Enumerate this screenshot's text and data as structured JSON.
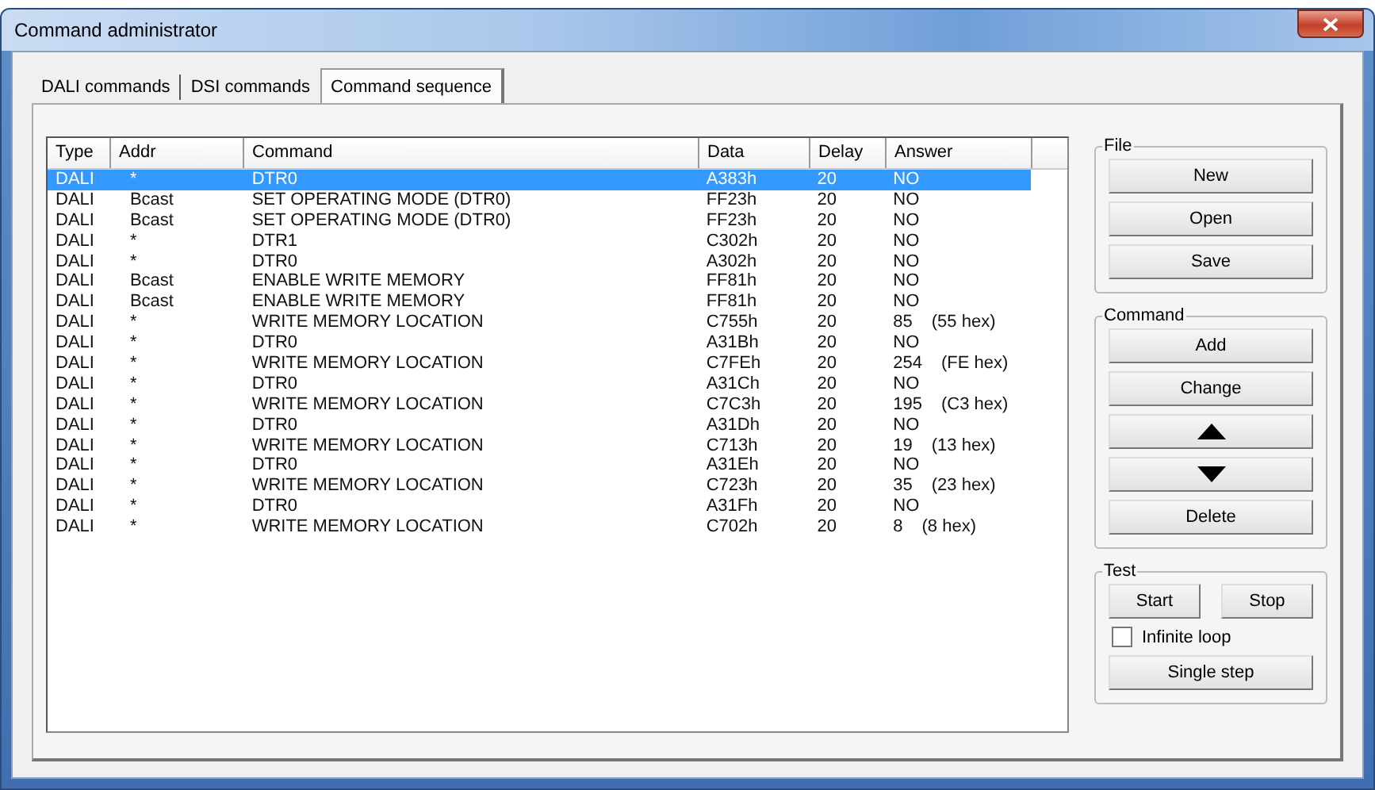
{
  "window": {
    "title": "Command administrator"
  },
  "tabs": [
    {
      "label": "DALI commands",
      "selected": false
    },
    {
      "label": "DSI commands",
      "selected": false
    },
    {
      "label": "Command sequence",
      "selected": true
    }
  ],
  "table": {
    "columns": [
      "Type",
      "Addr",
      "Command",
      "Data",
      "Delay",
      "Answer"
    ],
    "rows": [
      {
        "type": "DALI",
        "addr": "*",
        "command": "DTR0",
        "data": "A383h",
        "delay": "20",
        "answer": "NO",
        "selected": true
      },
      {
        "type": "DALI",
        "addr": "Bcast",
        "command": "SET OPERATING MODE (DTR0)",
        "data": "FF23h",
        "delay": "20",
        "answer": "NO",
        "selected": false
      },
      {
        "type": "DALI",
        "addr": "Bcast",
        "command": "SET OPERATING MODE (DTR0)",
        "data": "FF23h",
        "delay": "20",
        "answer": "NO",
        "selected": false
      },
      {
        "type": "DALI",
        "addr": "*",
        "command": "DTR1",
        "data": "C302h",
        "delay": "20",
        "answer": "NO",
        "selected": false
      },
      {
        "type": "DALI",
        "addr": "*",
        "command": "DTR0",
        "data": "A302h",
        "delay": "20",
        "answer": "NO",
        "selected": false
      },
      {
        "type": "DALI",
        "addr": "Bcast",
        "command": "ENABLE WRITE MEMORY",
        "data": "FF81h",
        "delay": "20",
        "answer": "NO",
        "selected": false
      },
      {
        "type": "DALI",
        "addr": "Bcast",
        "command": "ENABLE WRITE MEMORY",
        "data": "FF81h",
        "delay": "20",
        "answer": "NO",
        "selected": false
      },
      {
        "type": "DALI",
        "addr": "*",
        "command": "WRITE MEMORY LOCATION",
        "data": "C755h",
        "delay": "20",
        "answer": "85",
        "answer_hex": "(55 hex)",
        "selected": false
      },
      {
        "type": "DALI",
        "addr": "*",
        "command": "DTR0",
        "data": "A31Bh",
        "delay": "20",
        "answer": "NO",
        "selected": false
      },
      {
        "type": "DALI",
        "addr": "*",
        "command": "WRITE MEMORY LOCATION",
        "data": "C7FEh",
        "delay": "20",
        "answer": "254",
        "answer_hex": "(FE hex)",
        "selected": false
      },
      {
        "type": "DALI",
        "addr": "*",
        "command": "DTR0",
        "data": "A31Ch",
        "delay": "20",
        "answer": "NO",
        "selected": false
      },
      {
        "type": "DALI",
        "addr": "*",
        "command": "WRITE MEMORY LOCATION",
        "data": "C7C3h",
        "delay": "20",
        "answer": "195",
        "answer_hex": "(C3 hex)",
        "selected": false
      },
      {
        "type": "DALI",
        "addr": "*",
        "command": "DTR0",
        "data": "A31Dh",
        "delay": "20",
        "answer": "NO",
        "selected": false
      },
      {
        "type": "DALI",
        "addr": "*",
        "command": "WRITE MEMORY LOCATION",
        "data": "C713h",
        "delay": "20",
        "answer": "19",
        "answer_hex": "(13 hex)",
        "selected": false
      },
      {
        "type": "DALI",
        "addr": "*",
        "command": "DTR0",
        "data": "A31Eh",
        "delay": "20",
        "answer": "NO",
        "selected": false
      },
      {
        "type": "DALI",
        "addr": "*",
        "command": "WRITE MEMORY LOCATION",
        "data": "C723h",
        "delay": "20",
        "answer": "35",
        "answer_hex": "(23 hex)",
        "selected": false
      },
      {
        "type": "DALI",
        "addr": "*",
        "command": "DTR0",
        "data": "A31Fh",
        "delay": "20",
        "answer": "NO",
        "selected": false
      },
      {
        "type": "DALI",
        "addr": "*",
        "command": "WRITE MEMORY LOCATION",
        "data": "C702h",
        "delay": "20",
        "answer": "8",
        "answer_hex": "(8 hex)",
        "selected": false
      }
    ]
  },
  "file_group": {
    "title": "File",
    "buttons": [
      "New",
      "Open",
      "Save"
    ]
  },
  "command_group": {
    "title": "Command",
    "buttons": [
      {
        "kind": "text",
        "label": "Add"
      },
      {
        "kind": "text",
        "label": "Change"
      },
      {
        "kind": "up"
      },
      {
        "kind": "down"
      },
      {
        "kind": "text",
        "label": "Delete"
      }
    ]
  },
  "test_group": {
    "title": "Test",
    "start": "Start",
    "stop": "Stop",
    "infinite_loop": {
      "label": "Infinite loop",
      "checked": false
    },
    "single_step": "Single step"
  }
}
